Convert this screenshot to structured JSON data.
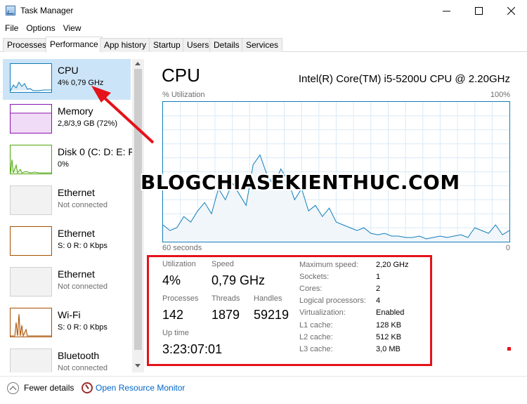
{
  "window": {
    "title": "Task Manager"
  },
  "menu": [
    "File",
    "Options",
    "View"
  ],
  "tabs": [
    "Processes",
    "Performance",
    "App history",
    "Startup",
    "Users",
    "Details",
    "Services"
  ],
  "sidebar": [
    {
      "name": "CPU",
      "sub": "4% 0,79 GHz"
    },
    {
      "name": "Memory",
      "sub": "2,8/3,9 GB (72%)"
    },
    {
      "name": "Disk 0 (C: D: E: F",
      "sub": "0%"
    },
    {
      "name": "Ethernet",
      "sub": "Not connected"
    },
    {
      "name": "Ethernet",
      "sub": "S: 0 R: 0 Kbps"
    },
    {
      "name": "Ethernet",
      "sub": "Not connected"
    },
    {
      "name": "Wi-Fi",
      "sub": "S: 0 R: 0 Kbps"
    },
    {
      "name": "Bluetooth",
      "sub": "Not connected"
    }
  ],
  "cpu": {
    "title": "CPU",
    "model": "Intel(R) Core(TM) i5-5200U CPU @ 2.20GHz",
    "util_label": "% Utilization",
    "max_label": "100%",
    "seconds_label": "60 seconds",
    "zero_label": "0",
    "graph_values": [
      12,
      8,
      10,
      18,
      14,
      22,
      28,
      20,
      38,
      30,
      42,
      34,
      26,
      55,
      62,
      48,
      40,
      52,
      44,
      30,
      38,
      22,
      26,
      18,
      24,
      14,
      12,
      10,
      8,
      10,
      6,
      5,
      6,
      4,
      4,
      3,
      3,
      4,
      2,
      3,
      4,
      3,
      4,
      5,
      3,
      10,
      8,
      6,
      12,
      5,
      8
    ],
    "stats": {
      "utilization": {
        "label": "Utilization",
        "value": "4%"
      },
      "speed": {
        "label": "Speed",
        "value": "0,79 GHz"
      },
      "processes": {
        "label": "Processes",
        "value": "142"
      },
      "threads": {
        "label": "Threads",
        "value": "1879"
      },
      "handles": {
        "label": "Handles",
        "value": "59219"
      },
      "uptime": {
        "label": "Up time",
        "value": "3:23:07:01"
      }
    },
    "specs": [
      {
        "label": "Maximum speed:",
        "value": "2,20 GHz"
      },
      {
        "label": "Sockets:",
        "value": "1"
      },
      {
        "label": "Cores:",
        "value": "2"
      },
      {
        "label": "Logical processors:",
        "value": "4"
      },
      {
        "label": "Virtualization:",
        "value": "Enabled"
      },
      {
        "label": "L1 cache:",
        "value": "128 KB"
      },
      {
        "label": "L2 cache:",
        "value": "512 KB"
      },
      {
        "label": "L3 cache:",
        "value": "3,0 MB"
      }
    ]
  },
  "watermark": "BLOGCHIASEKIENTHUC.COM",
  "bottom": {
    "fewer": "Fewer details",
    "resource_monitor": "Open Resource Monitor"
  },
  "colors": {
    "cpu": "#117dbb",
    "memory": "#8b12ae",
    "disk": "#4da60c",
    "ethernet": "#a74f01",
    "annotation": "#e5121a",
    "selected": "#cce4f7"
  }
}
